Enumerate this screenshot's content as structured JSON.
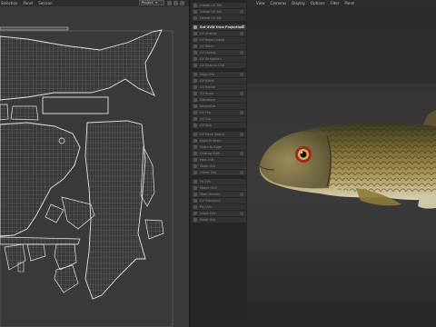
{
  "uv_editor": {
    "menu": [
      "Selection",
      "Panel",
      "Session"
    ],
    "dropdown_value": "Project"
  },
  "tool_panel": {
    "items": [
      {
        "label": "Create UV Tile",
        "active": false
      },
      {
        "label": "Create UV Set",
        "active": false
      },
      {
        "label": "Delete UV Set",
        "active": false
      },
      {
        "label": "Set UVW from Projection",
        "active": true
      },
      {
        "label": "UV Unwrap",
        "active": false
      },
      {
        "label": "UV Relax Unfold",
        "active": false
      },
      {
        "label": "UV Stitch",
        "active": false
      },
      {
        "label": "UV Layout",
        "active": false
      },
      {
        "label": "UV Straighten",
        "active": false
      },
      {
        "label": "UV Snap to Grid",
        "active": false
      },
      {
        "label": "Align UVs",
        "active": false
      },
      {
        "label": "UV Mirror",
        "active": false
      },
      {
        "label": "UV Rotate",
        "active": false
      },
      {
        "label": "UV Scale",
        "active": false
      },
      {
        "label": "Distribute",
        "active": false
      },
      {
        "label": "Normalize",
        "active": false
      },
      {
        "label": "UV Flip",
        "active": false
      },
      {
        "label": "UV Cut",
        "active": false
      },
      {
        "label": "UV Sew",
        "active": false
      },
      {
        "label": "UV Move Seams",
        "active": false
      },
      {
        "label": "Edge to Seam",
        "active": false
      },
      {
        "label": "Seam to Edge",
        "active": false
      },
      {
        "label": "Unwrap Shell",
        "active": false
      },
      {
        "label": "Pack UVs",
        "active": false
      },
      {
        "label": "Stack UVs",
        "active": false
      },
      {
        "label": "Orient UVs",
        "active": false
      },
      {
        "label": "Fit UVs",
        "active": false
      },
      {
        "label": "Match Grid",
        "active": false
      },
      {
        "label": "Texel Density",
        "active": false
      },
      {
        "label": "UV Transform",
        "active": false
      },
      {
        "label": "Pin UVs",
        "active": false
      },
      {
        "label": "Unpin UVs",
        "active": false
      },
      {
        "label": "Reset UVs",
        "active": false
      }
    ]
  },
  "viewport": {
    "menu": [
      "View",
      "Cameras",
      "Display",
      "Options",
      "Filter",
      "Panel"
    ]
  }
}
